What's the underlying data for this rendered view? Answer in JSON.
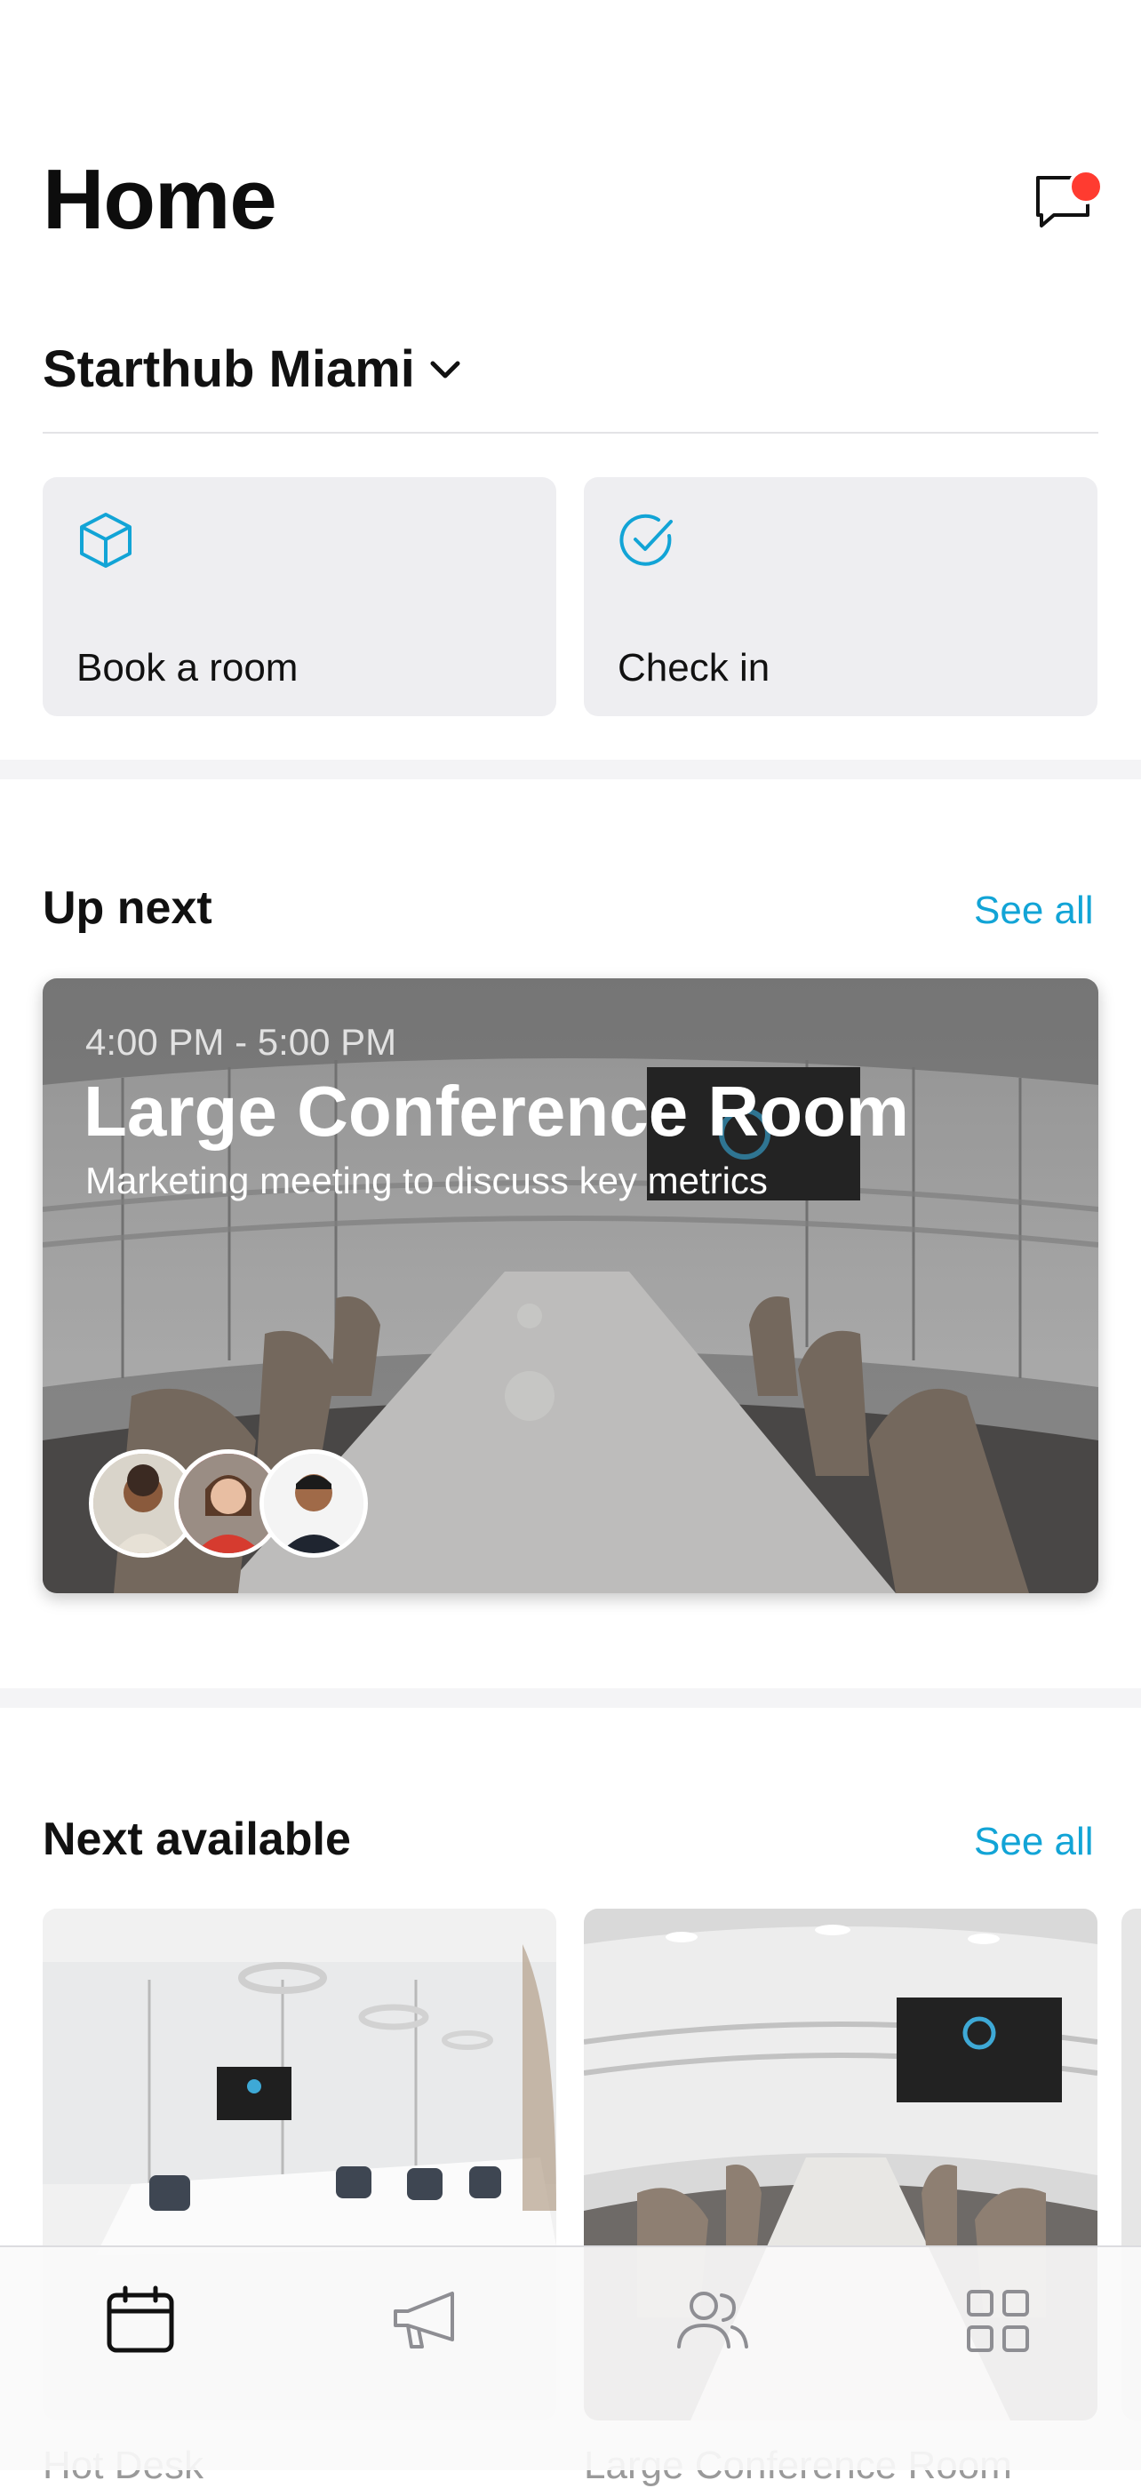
{
  "header": {
    "title": "Home",
    "messages_icon": "chat-bubble-icon",
    "unread_color": "#ff3b30"
  },
  "location": {
    "name": "Starthub Miami",
    "icon": "chevron-down-icon"
  },
  "quick_actions": [
    {
      "label": "Book a room",
      "icon": "cube-icon"
    },
    {
      "label": "Check in",
      "icon": "check-circle-icon"
    }
  ],
  "accent_color": "#12a4d6",
  "up_next": {
    "title": "Up next",
    "see_all": "See all",
    "booking": {
      "time": "4:00 PM - 5:00 PM",
      "room": "Large Conference Room",
      "description": "Marketing meeting to discuss key metrics",
      "attendees": [
        "attendee-1-avatar",
        "attendee-2-avatar",
        "attendee-3-avatar"
      ]
    }
  },
  "next_available": {
    "title": "Next available",
    "see_all": "See all",
    "rooms": [
      {
        "image": "meeting-room-photo",
        "caption": "Hot Desk"
      },
      {
        "image": "conference-room-photo",
        "caption": "Large Conference Room"
      }
    ]
  },
  "tabbar": {
    "tabs": [
      {
        "icon": "calendar-icon",
        "active": true
      },
      {
        "icon": "megaphone-icon",
        "active": false
      },
      {
        "icon": "people-icon",
        "active": false
      },
      {
        "icon": "grid-icon",
        "active": false
      }
    ]
  }
}
